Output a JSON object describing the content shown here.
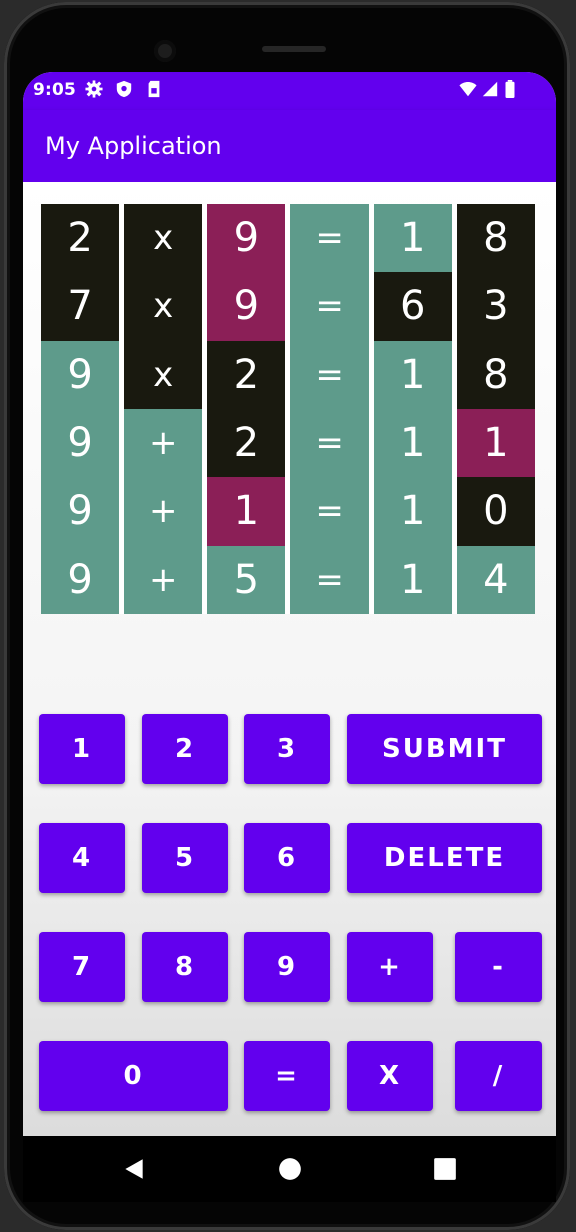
{
  "status_bar": {
    "time": "9:05",
    "left_icons": [
      "settings-icon",
      "shield-icon",
      "sim-card-icon"
    ],
    "right_icons": [
      "wifi-icon",
      "signal-icon",
      "battery-icon"
    ]
  },
  "app_bar": {
    "title": "My Application"
  },
  "colors": {
    "primary": "#6200ee",
    "tile_green": "#5e9b8b",
    "tile_dark": "#19190f",
    "tile_maroon": "#8b1f57"
  },
  "grid": {
    "rows": [
      [
        {
          "v": "2",
          "c": "dark"
        },
        {
          "v": "x",
          "c": "dark"
        },
        {
          "v": "9",
          "c": "maroon"
        },
        {
          "v": "=",
          "c": "green"
        },
        {
          "v": "1",
          "c": "green"
        },
        {
          "v": "8",
          "c": "dark"
        }
      ],
      [
        {
          "v": "7",
          "c": "dark"
        },
        {
          "v": "x",
          "c": "dark"
        },
        {
          "v": "9",
          "c": "maroon"
        },
        {
          "v": "=",
          "c": "green"
        },
        {
          "v": "6",
          "c": "dark"
        },
        {
          "v": "3",
          "c": "dark"
        }
      ],
      [
        {
          "v": "9",
          "c": "green"
        },
        {
          "v": "x",
          "c": "dark"
        },
        {
          "v": "2",
          "c": "dark"
        },
        {
          "v": "=",
          "c": "green"
        },
        {
          "v": "1",
          "c": "green"
        },
        {
          "v": "8",
          "c": "dark"
        }
      ],
      [
        {
          "v": "9",
          "c": "green"
        },
        {
          "v": "+",
          "c": "green"
        },
        {
          "v": "2",
          "c": "dark"
        },
        {
          "v": "=",
          "c": "green"
        },
        {
          "v": "1",
          "c": "green"
        },
        {
          "v": "1",
          "c": "maroon"
        }
      ],
      [
        {
          "v": "9",
          "c": "green"
        },
        {
          "v": "+",
          "c": "green"
        },
        {
          "v": "1",
          "c": "maroon"
        },
        {
          "v": "=",
          "c": "green"
        },
        {
          "v": "1",
          "c": "green"
        },
        {
          "v": "0",
          "c": "dark"
        }
      ],
      [
        {
          "v": "9",
          "c": "green"
        },
        {
          "v": "+",
          "c": "green"
        },
        {
          "v": "5",
          "c": "green"
        },
        {
          "v": "=",
          "c": "green"
        },
        {
          "v": "1",
          "c": "green"
        },
        {
          "v": "4",
          "c": "green"
        }
      ]
    ]
  },
  "keypad": {
    "k1": "1",
    "k2": "2",
    "k3": "3",
    "submit": "SUBMIT",
    "k4": "4",
    "k5": "5",
    "k6": "6",
    "delete": "DELETE",
    "k7": "7",
    "k8": "8",
    "k9": "9",
    "plus": "+",
    "minus": "-",
    "k0": "0",
    "equals": "=",
    "times": "X",
    "divide": "/"
  },
  "nav_bar": {
    "icons": [
      "back-icon",
      "home-icon",
      "recents-icon"
    ]
  }
}
